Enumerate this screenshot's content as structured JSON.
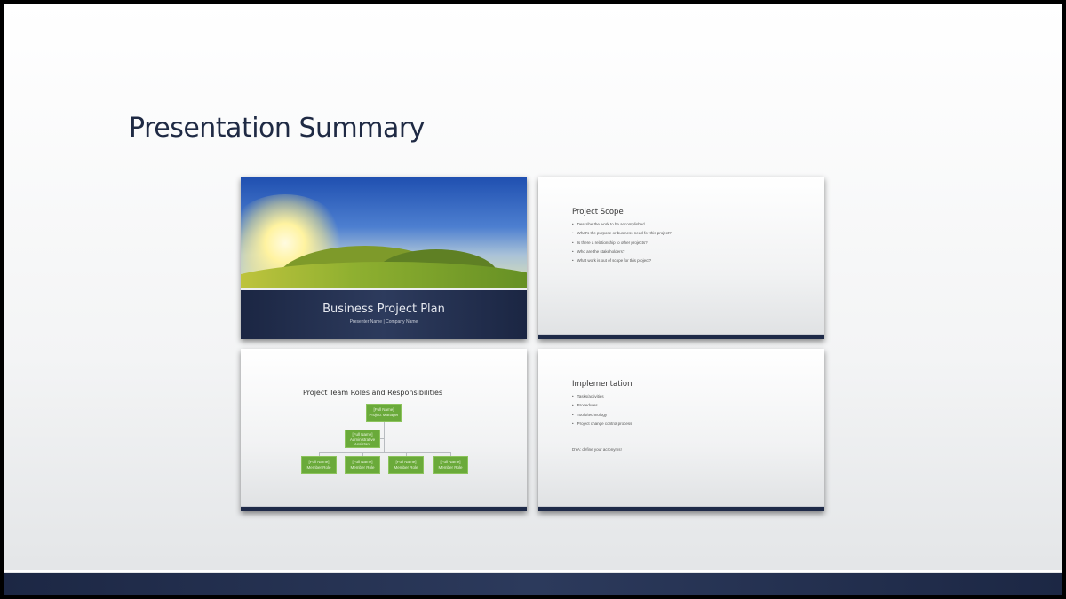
{
  "page": {
    "title": "Presentation Summary"
  },
  "slides": [
    {
      "title": "Business Project Plan",
      "subtitle": "Presenter Name | Company Name"
    },
    {
      "title": "Project Scope",
      "bullets": [
        "Describe the work to be accomplished",
        "What's the purpose or business need for this project?",
        "Is there a relationship to other projects?",
        "Who are the stakeholders?",
        "What work is out of scope for this project?"
      ]
    },
    {
      "title": "Project Team Roles and Responsibilities",
      "org": {
        "manager": [
          "[Full Name]",
          "Project Manager"
        ],
        "assistant": [
          "[Full Name]",
          "Administrative",
          "Assistant"
        ],
        "members": [
          [
            "[Full Name]",
            "Member Role"
          ],
          [
            "[Full Name]",
            "Member Role"
          ],
          [
            "[Full Name]",
            "Member Role"
          ],
          [
            "[Full Name]",
            "Member Role"
          ]
        ]
      }
    },
    {
      "title": "Implementation",
      "bullets": [
        "Tasks/activities",
        "Procedures",
        "Tools/technology",
        "Project change control process"
      ],
      "note": "DYA: define your acronyms!"
    }
  ],
  "colors": {
    "navy": "#1e2a48",
    "green": "#6aaa3a"
  }
}
